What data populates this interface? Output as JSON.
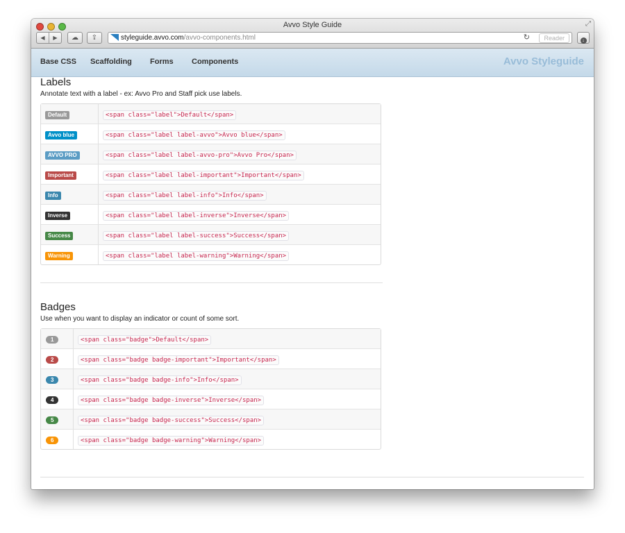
{
  "window": {
    "title": "Avvo Style Guide"
  },
  "browser": {
    "url_host": "styleguide.avvo.com",
    "url_path": "/avvo-components.html",
    "reader_label": "Reader"
  },
  "nav": {
    "items": [
      "Base CSS",
      "Scaffolding",
      "Forms",
      "Components"
    ],
    "brand": "Avvo Styleguide"
  },
  "labels_section": {
    "title": "Labels",
    "description": "Annotate text with a label - ex: Avvo Pro and Staff pick use labels.",
    "rows": [
      {
        "label": "Default",
        "code": "<span class=\"label\">Default</span>",
        "color": "#999999"
      },
      {
        "label": "Avvo blue",
        "code": "<span class=\"label label-avvo\">Avvo blue</span>",
        "color": "#0090c8"
      },
      {
        "label": "AVVO PRO",
        "code": "<span class=\"label label-avvo-pro\">Avvo Pro</span>",
        "color": "#5b9cc4"
      },
      {
        "label": "Important",
        "code": "<span class=\"label label-important\">Important</span>",
        "color": "#b94a48"
      },
      {
        "label": "Info",
        "code": "<span class=\"label label-info\">Info</span>",
        "color": "#3a87ad"
      },
      {
        "label": "Inverse",
        "code": "<span class=\"label label-inverse\">Inverse</span>",
        "color": "#333333"
      },
      {
        "label": "Success",
        "code": "<span class=\"label label-success\">Success</span>",
        "color": "#468847"
      },
      {
        "label": "Warning",
        "code": "<span class=\"label label-warning\">Warning</span>",
        "color": "#f89406"
      }
    ]
  },
  "badges_section": {
    "title": "Badges",
    "description": "Use when you want to display an indicator or count of some sort.",
    "rows": [
      {
        "badge": "1",
        "code": "<span class=\"badge\">Default</span>",
        "color": "#999999"
      },
      {
        "badge": "2",
        "code": "<span class=\"badge badge-important\">Important</span>",
        "color": "#b94a48"
      },
      {
        "badge": "3",
        "code": "<span class=\"badge badge-info\">Info</span>",
        "color": "#3a87ad"
      },
      {
        "badge": "4",
        "code": "<span class=\"badge badge-inverse\">Inverse</span>",
        "color": "#333333"
      },
      {
        "badge": "5",
        "code": "<span class=\"badge badge-success\">Success</span>",
        "color": "#468847"
      },
      {
        "badge": "6",
        "code": "<span class=\"badge badge-warning\">Warning</span>",
        "color": "#f89406"
      }
    ]
  }
}
